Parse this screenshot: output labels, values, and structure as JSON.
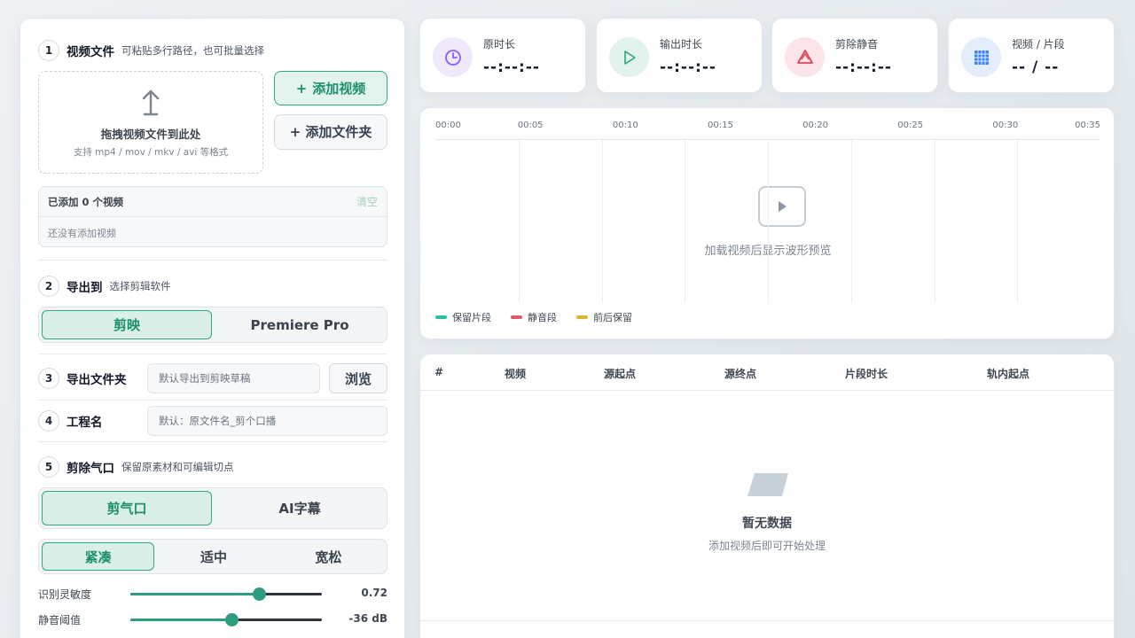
{
  "sections": {
    "video": {
      "num": "1",
      "title": "视频文件",
      "subtitle": "可粘贴多行路径，也可批量选择",
      "dropzone_title": "拖拽视频文件到此处",
      "dropzone_hint": "支持 mp4 / mov / mkv / avi 等格式",
      "add_video_label": "添加视频",
      "add_folder_label": "添加文件夹",
      "plus": "+",
      "list_count": "已添加 0 个视频",
      "clear_label": "清空",
      "empty_text": "还没有添加视频"
    },
    "export_to": {
      "num": "2",
      "title": "导出到",
      "subtitle": "选择剪辑软件",
      "options": [
        "剪映",
        "Premiere Pro"
      ],
      "selected": "剪映"
    },
    "export_folder": {
      "num": "3",
      "title": "导出文件夹",
      "placeholder": "默认导出到剪映草稿",
      "browse_label": "浏览"
    },
    "project_name": {
      "num": "4",
      "title": "工程名",
      "placeholder": "默认：原文件名_剪个口播"
    },
    "cut_breath": {
      "num": "5",
      "title": "剪除气口",
      "subtitle": "保留原素材和可编辑切点",
      "modes": [
        "剪气口",
        "AI字幕"
      ],
      "selected_mode": "剪气口",
      "presets": [
        "紧凑",
        "适中",
        "宽松"
      ],
      "selected_preset": "紧凑",
      "sliders": [
        {
          "label": "识别灵敏度",
          "value_text": "0.72",
          "fraction": 0.67
        },
        {
          "label": "静音阈值",
          "value_text": "-36 dB",
          "fraction": 0.53
        }
      ]
    }
  },
  "stats": [
    {
      "label": "原时长",
      "value": "--:--:--",
      "icon": "clock-icon",
      "color": "#8b5cf6",
      "bg": "#efe9fb"
    },
    {
      "label": "输出时长",
      "value": "--:--:--",
      "icon": "play-icon",
      "color": "#2aa381",
      "bg": "#e2f3ed"
    },
    {
      "label": "剪除静音",
      "value": "--:--:--",
      "icon": "recycle-icon",
      "color": "#e0475a",
      "bg": "#fbe5e8"
    },
    {
      "label": "视频 / 片段",
      "value": "-- / --",
      "icon": "grid-icon",
      "color": "#3b82f6",
      "bg": "#e3edfb"
    }
  ],
  "waveform": {
    "ticks": [
      "00:00",
      "00:05",
      "00:10",
      "00:15",
      "00:20",
      "00:25",
      "00:30",
      "00:35"
    ],
    "hint": "加载视频后显示波形预览",
    "legend": [
      {
        "label": "保留片段",
        "color": "#22c3a0"
      },
      {
        "label": "静音段",
        "color": "#e4576a"
      },
      {
        "label": "前后保留",
        "color": "#e3b52a"
      }
    ]
  },
  "table": {
    "columns": [
      "#",
      "视频",
      "源起点",
      "源终点",
      "片段时长",
      "轨内起点"
    ],
    "empty_title": "暂无数据",
    "empty_hint": "添加视频后即可开始处理"
  }
}
